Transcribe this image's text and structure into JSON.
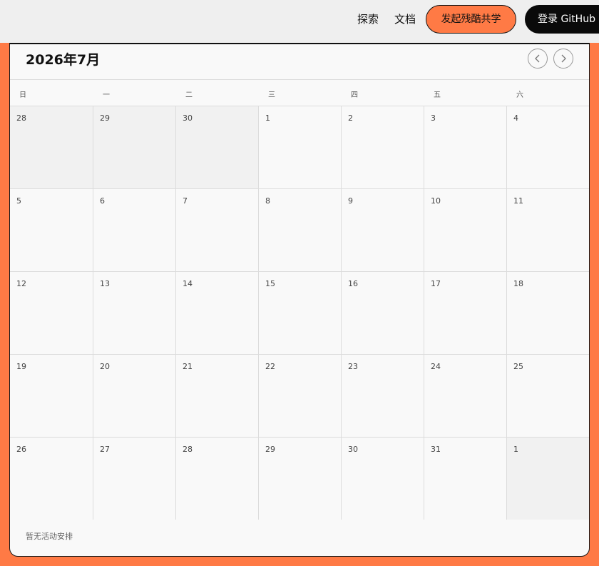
{
  "nav": {
    "explore": "探索",
    "docs": "文档",
    "share_button": "发起残酷共学",
    "login_button": "登录 GitHub"
  },
  "calendar": {
    "month_title": "2026年7月",
    "prev_icon": "chevron-left-icon",
    "next_icon": "chevron-right-icon",
    "weekdays": [
      "日",
      "一",
      "二",
      "三",
      "四",
      "五",
      "六"
    ],
    "weeks": [
      [
        {
          "d": "28",
          "other": true
        },
        {
          "d": "29",
          "other": true
        },
        {
          "d": "30",
          "other": true
        },
        {
          "d": "1"
        },
        {
          "d": "2"
        },
        {
          "d": "3"
        },
        {
          "d": "4"
        }
      ],
      [
        {
          "d": "5"
        },
        {
          "d": "6"
        },
        {
          "d": "7"
        },
        {
          "d": "8"
        },
        {
          "d": "9"
        },
        {
          "d": "10"
        },
        {
          "d": "11"
        }
      ],
      [
        {
          "d": "12"
        },
        {
          "d": "13"
        },
        {
          "d": "14"
        },
        {
          "d": "15"
        },
        {
          "d": "16"
        },
        {
          "d": "17"
        },
        {
          "d": "18"
        }
      ],
      [
        {
          "d": "19"
        },
        {
          "d": "20"
        },
        {
          "d": "21"
        },
        {
          "d": "22"
        },
        {
          "d": "23"
        },
        {
          "d": "24"
        },
        {
          "d": "25"
        }
      ],
      [
        {
          "d": "26"
        },
        {
          "d": "27"
        },
        {
          "d": "28"
        },
        {
          "d": "29"
        },
        {
          "d": "30"
        },
        {
          "d": "31"
        },
        {
          "d": "1",
          "other": true
        }
      ]
    ],
    "empty_message": "暂无活动安排"
  },
  "colors": {
    "accent": "#ff7a45",
    "topbar": "#efefef",
    "card": "#f9f9f9",
    "other_month": "#f1f1f1"
  }
}
